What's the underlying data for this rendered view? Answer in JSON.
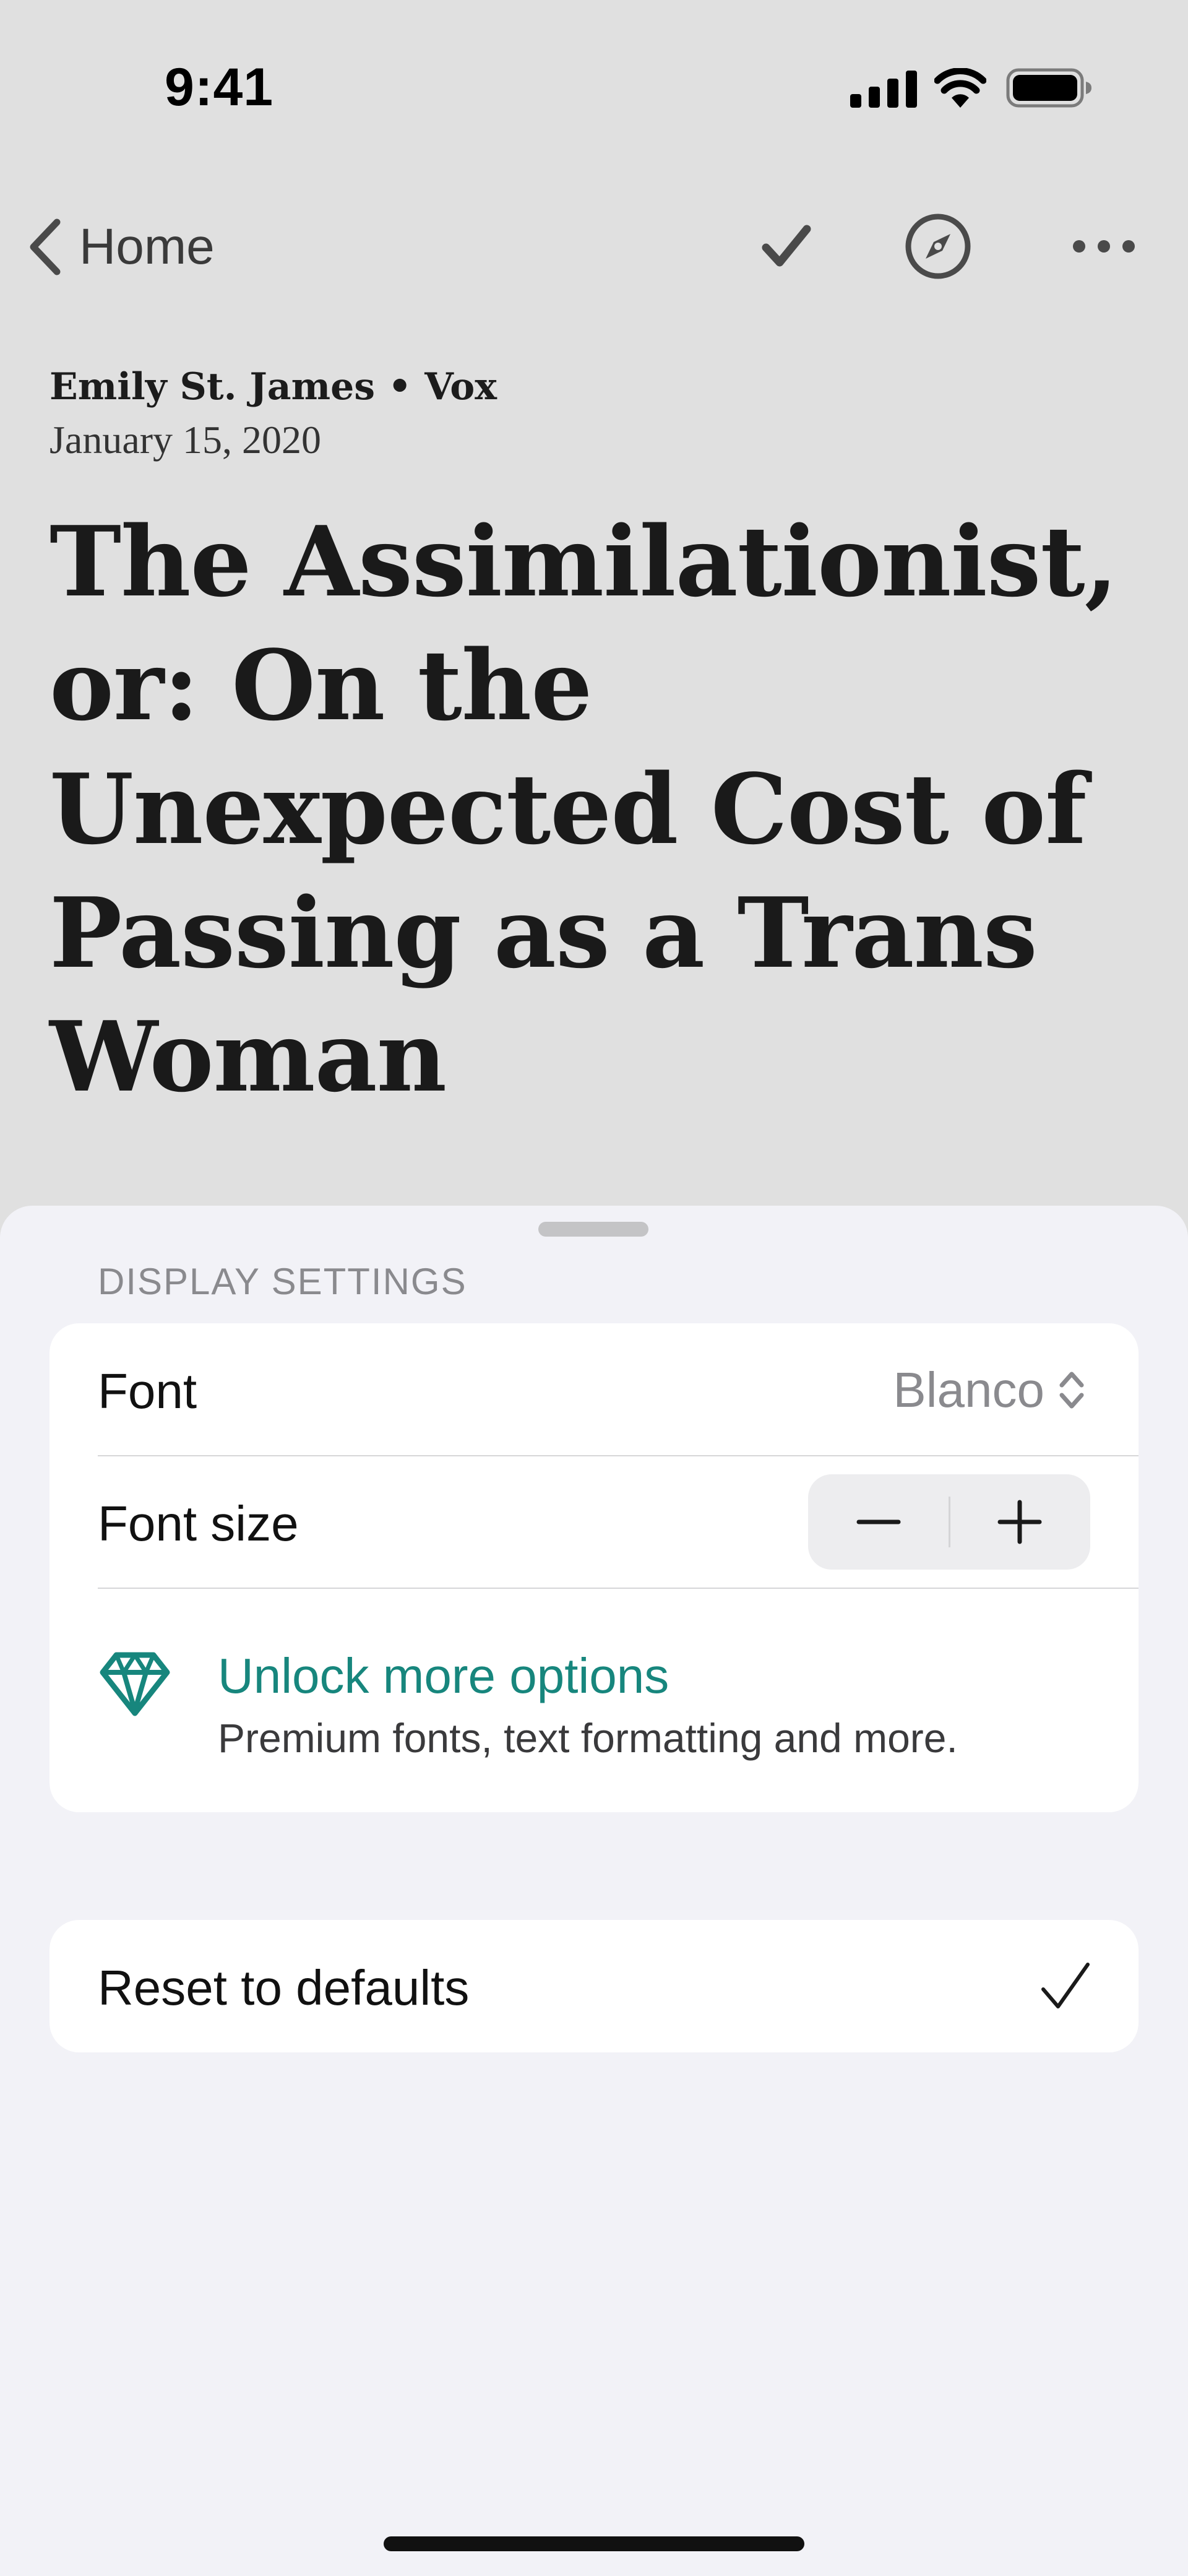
{
  "status_bar": {
    "time": "9:41",
    "icons": [
      "cellular-signal-icon",
      "wifi-icon",
      "battery-icon"
    ]
  },
  "nav": {
    "back_label": "Home",
    "icons": [
      "checkmark-icon",
      "compass-icon",
      "more-icon"
    ]
  },
  "article": {
    "byline": "Emily St. James • Vox",
    "date": "January 15, 2020",
    "title_lines": [
      "The Assimilationist,",
      "or: On the",
      "Unexpected Cost of",
      "Passing as a Trans",
      "Woman"
    ]
  },
  "sheet": {
    "section_header": "DISPLAY SETTINGS",
    "font_row": {
      "label": "Font",
      "value": "Blanco"
    },
    "font_size_row": {
      "label": "Font size"
    },
    "unlock": {
      "title": "Unlock more options",
      "subtitle": "Premium fonts, text formatting and more.",
      "icon": "diamond-icon"
    },
    "reset_label": "Reset to defaults"
  },
  "colors": {
    "background": "#e0e0e0",
    "sheet": "#f2f2f7",
    "accent": "#17867d",
    "secondary_text": "#8a8a8e"
  }
}
